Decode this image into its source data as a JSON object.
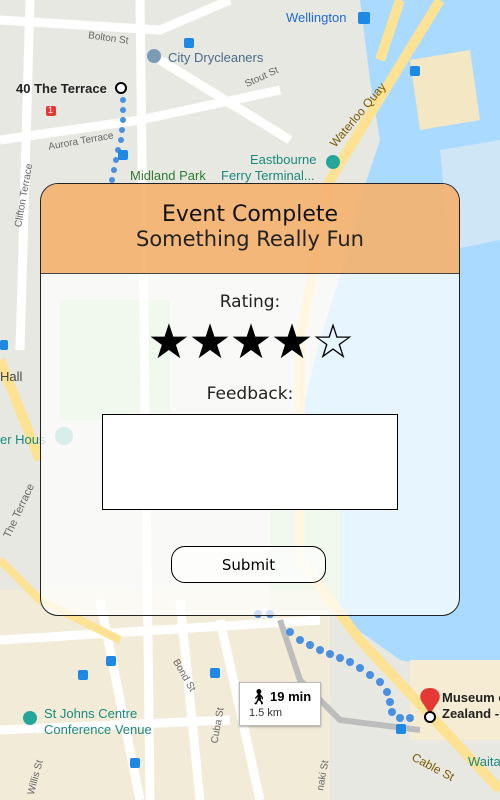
{
  "map": {
    "labels": {
      "wellington": "Wellington",
      "bolton_st": "Bolton St",
      "city_drycleaners": "City Drycleaners",
      "stout_st": "Stout St",
      "terrace_40": "40 The Terrace",
      "waterloo_quay": "Waterloo Quay",
      "aurora_terrace": "Aurora Terrace",
      "eastbourne": "Eastbourne",
      "midland_park": "Midland Park",
      "ferry_terminal": "Ferry Terminal...",
      "clifton_terrace": "Clifton Terrace",
      "the_terrace": "The Terrace",
      "hall": "Hall",
      "er_hous": "er Hous",
      "st_johns_1": "St Johns Centre",
      "st_johns_2": "Conference Venue",
      "bond_st": "Bond St",
      "cuba_st": "Cuba St",
      "cable_st": "Cable St",
      "museum_1": "Museum o",
      "museum_2": "Zealand -",
      "waita": "Waita",
      "willis_st": "Willis St",
      "hinaki_st": "naki St",
      "route_marker": "1"
    },
    "route_card": {
      "time": "19 min",
      "distance": "1.5 km"
    }
  },
  "modal": {
    "title": "Event Complete",
    "subtitle": "Something Really Fun",
    "rating_label": "Rating:",
    "rating": {
      "value": 4,
      "max": 5
    },
    "feedback_label": "Feedback:",
    "feedback_value": "",
    "submit_label": "Submit"
  },
  "colors": {
    "header": "#f2a050",
    "water": "#aadaff",
    "road_major": "#fde293",
    "route": "#4a90e2"
  }
}
